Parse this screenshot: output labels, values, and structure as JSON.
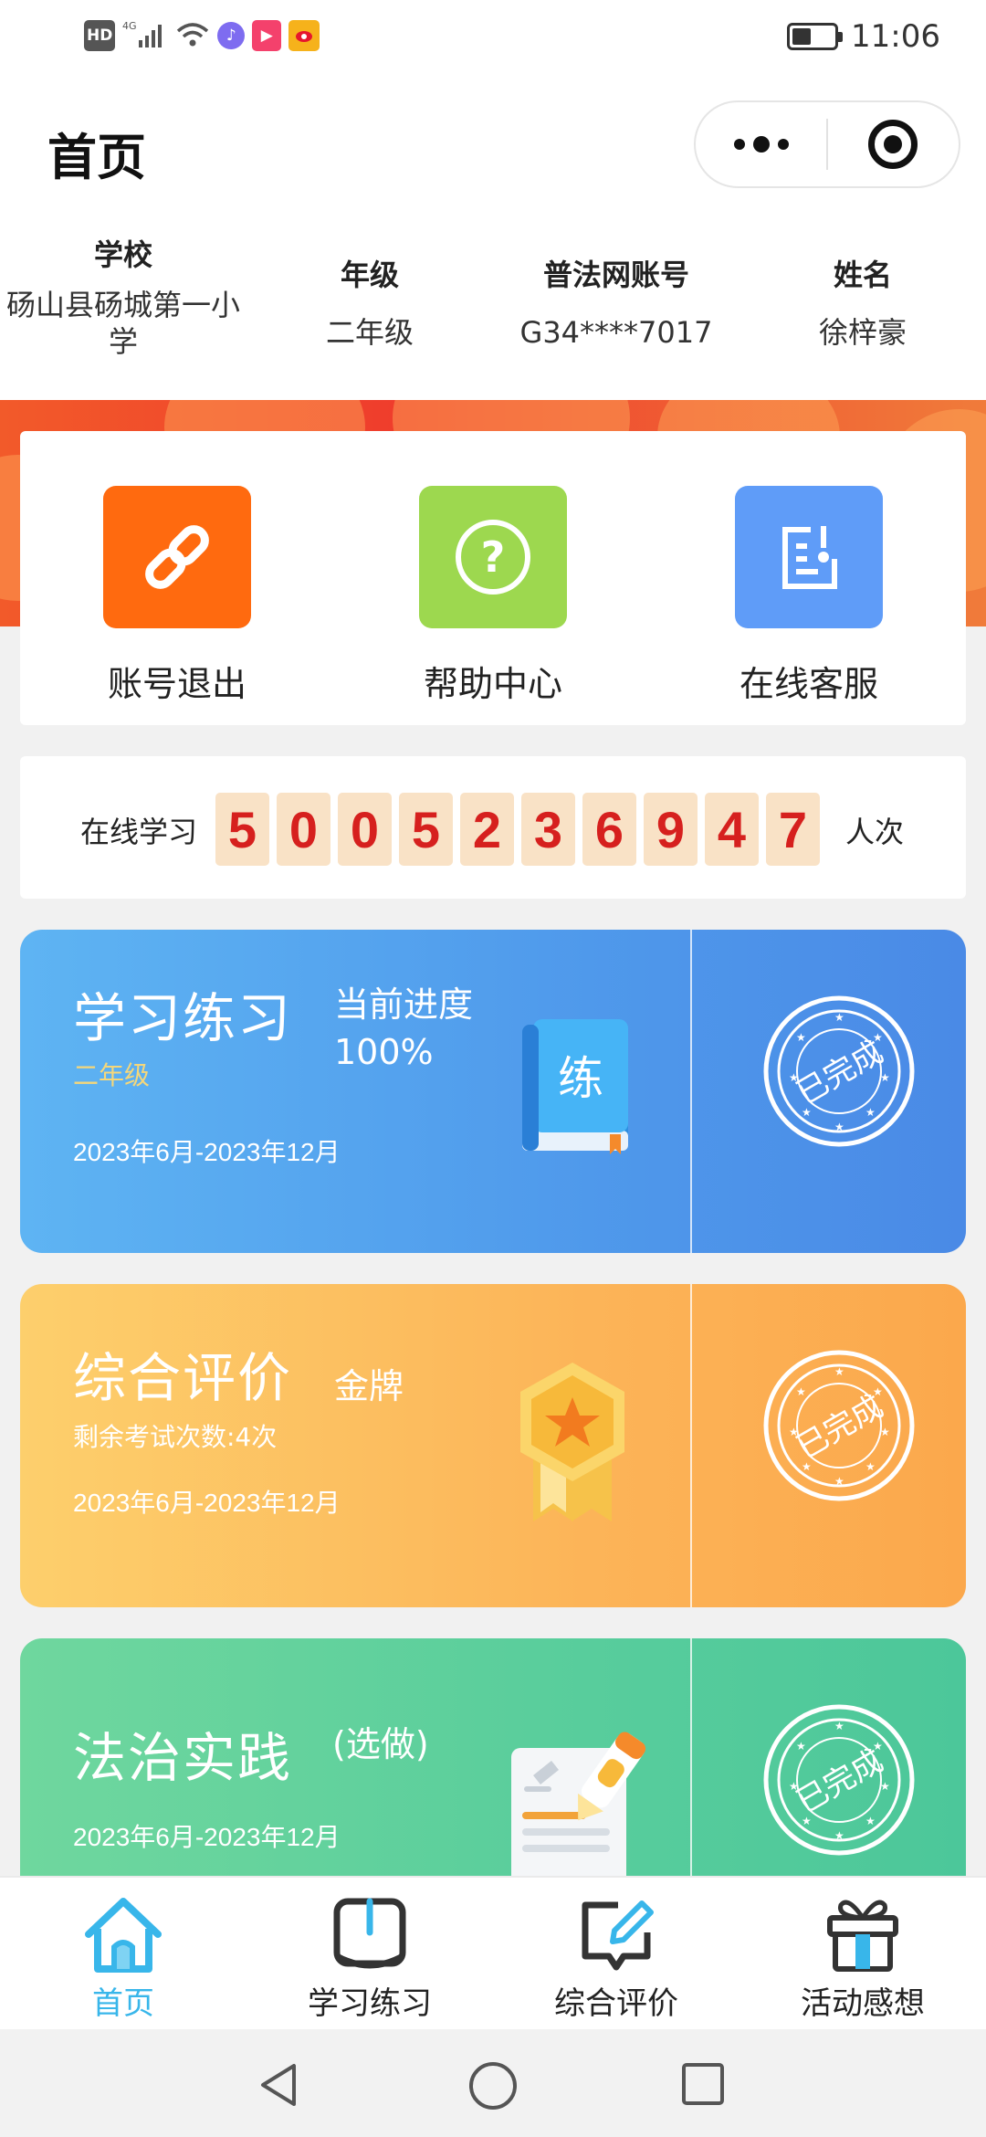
{
  "status_bar": {
    "hd": "HD",
    "signal": "4G",
    "time": "11:06",
    "battery_level": 0.45,
    "app_icons": [
      "music-app-icon",
      "video-app-icon",
      "weibo-icon"
    ]
  },
  "header": {
    "title": "首页"
  },
  "profile": {
    "school_label": "学校",
    "school_value": "砀山县砀城第一小学",
    "grade_label": "年级",
    "grade_value": "二年级",
    "account_label": "普法网账号",
    "account_value": "G34****7017",
    "name_label": "姓名",
    "name_value": "徐梓豪"
  },
  "quick_menu": [
    {
      "label": "账号退出",
      "icon": "link-icon",
      "color": "#ff6a0f"
    },
    {
      "label": "帮助中心",
      "icon": "question-icon",
      "color": "#9dd84f"
    },
    {
      "label": "在线客服",
      "icon": "document-edit-icon",
      "color": "#5f9cf8"
    }
  ],
  "counter": {
    "lead": "在线学习",
    "digits": [
      "5",
      "0",
      "0",
      "5",
      "2",
      "3",
      "6",
      "9",
      "4",
      "7"
    ],
    "tail": "人次"
  },
  "cards": {
    "study": {
      "title": "学习练习",
      "status_line1": "当前进度",
      "status_line2": "100%",
      "sub": "二年级",
      "dates": "2023年6月-2023年12月",
      "book_char": "练",
      "stamp": "已完成"
    },
    "evaluation": {
      "title": "综合评价",
      "status": "金牌",
      "sub": "剩余考试次数:4次",
      "dates": "2023年6月-2023年12月",
      "stamp": "已完成"
    },
    "practice": {
      "title": "法治实践",
      "status": "(选做)",
      "dates": "2023年6月-2023年12月",
      "stamp": "已完成"
    }
  },
  "tabs": [
    {
      "label": "首页",
      "icon": "home-icon",
      "active": true
    },
    {
      "label": "学习练习",
      "icon": "book-icon",
      "active": false
    },
    {
      "label": "综合评价",
      "icon": "edit-icon",
      "active": false
    },
    {
      "label": "活动感想",
      "icon": "gift-icon",
      "active": false
    }
  ],
  "colors": {
    "active_tab": "#38b6ea",
    "digit_red": "#d6201e",
    "digit_bg": "#f9e2c6",
    "sub_yellow": "#f5d77a"
  }
}
